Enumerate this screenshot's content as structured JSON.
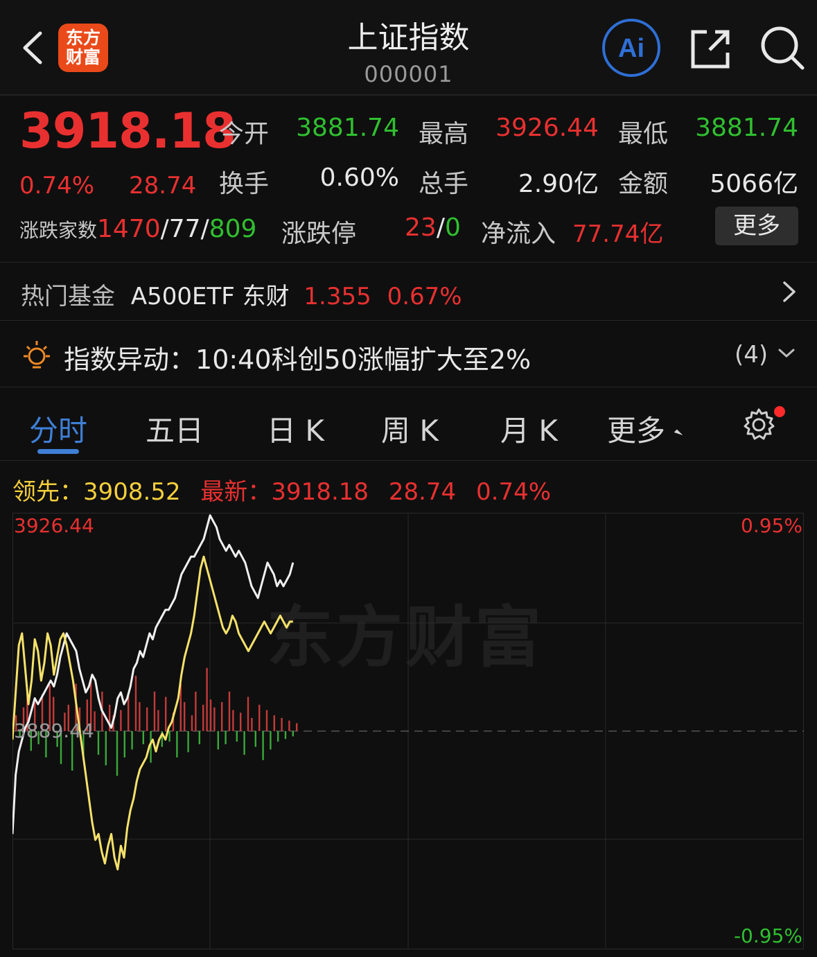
{
  "header": {
    "logo_text_line1": "东方",
    "logo_text_line2": "财富",
    "title": "上证指数",
    "code": "000001",
    "ai_label": "Ai",
    "icons": [
      "back-icon",
      "share-icon",
      "search-icon"
    ]
  },
  "quote": {
    "price": "3918.18",
    "change_pct": "0.74%",
    "change_amt": "28.74",
    "open_label": "今开",
    "open": "3881.74",
    "high_label": "最高",
    "high": "3926.44",
    "low_label": "最低",
    "low": "3881.74",
    "turnover_label": "换手",
    "turnover": "0.60%",
    "volume_label": "总手",
    "volume": "2.90亿",
    "amount_label": "金额",
    "amount": "5066亿",
    "adv_label": "涨跌家数",
    "adv_up": "1470",
    "adv_flat": "77",
    "adv_down": "809",
    "limit_label": "涨跌停",
    "limit_up": "23",
    "limit_down": "0",
    "inflow_label": "净流入",
    "inflow": "77.74亿",
    "more_label": "更多",
    "colors": {
      "up": "#e93030",
      "down": "#2fc02f"
    }
  },
  "hot_fund": {
    "label": "热门基金",
    "name": "A500ETF 东财",
    "price": "1.355",
    "pct": "0.67%"
  },
  "alert": {
    "label": "指数异动：",
    "text": "10:40科创50涨幅扩大至2%",
    "count": "(4)"
  },
  "tabs": [
    {
      "label": "分时"
    },
    {
      "label": "五日"
    },
    {
      "label": "日 K"
    },
    {
      "label": "周 K"
    },
    {
      "label": "月 K"
    },
    {
      "label": "更多"
    }
  ],
  "info_line": {
    "lead_label": "领先：",
    "lead": "3908.52",
    "latest_label": "最新：",
    "latest": "3918.18",
    "latest_chg": "28.74",
    "latest_pct": "0.74%"
  },
  "chart_data": {
    "type": "line",
    "watermark": "东方财富",
    "y_top_label": "3926.44",
    "y_mid_label": "3889.44",
    "pct_top_label": "0.95%",
    "pct_bottom_label": "-0.95%",
    "ylim": [
      3852.44,
      3926.44
    ],
    "prev_close": 3889.44,
    "series": [
      {
        "color": "#f0f0f0",
        "values": [
          3872,
          3882,
          3886,
          3888,
          3890,
          3891,
          3893,
          3895,
          3894,
          3895,
          3896,
          3897,
          3898,
          3897,
          3899,
          3902,
          3904,
          3906,
          3905,
          3904,
          3903,
          3900,
          3898,
          3896,
          3897,
          3899,
          3898,
          3895,
          3893,
          3892,
          3891,
          3890,
          3892,
          3895,
          3896,
          3894,
          3895,
          3897,
          3900,
          3901,
          3903,
          3902,
          3904,
          3906,
          3905,
          3907,
          3908,
          3909,
          3910,
          3910,
          3911,
          3912,
          3914,
          3916,
          3917,
          3918,
          3919,
          3919,
          3920,
          3921,
          3922,
          3924,
          3926,
          3925,
          3924,
          3922,
          3921,
          3920,
          3921,
          3920,
          3919,
          3920,
          3919,
          3918,
          3916,
          3914,
          3913,
          3912,
          3914,
          3916,
          3918,
          3917,
          3916,
          3914,
          3915,
          3914,
          3915,
          3916,
          3918
        ]
      },
      {
        "color": "#f5e26a",
        "values": [
          3888,
          3896,
          3904,
          3906,
          3900,
          3894,
          3898,
          3905,
          3903,
          3898,
          3901,
          3906,
          3904,
          3899,
          3902,
          3905,
          3906,
          3904,
          3901,
          3898,
          3894,
          3890,
          3886,
          3882,
          3878,
          3874,
          3871,
          3872,
          3869,
          3867,
          3870,
          3872,
          3868,
          3866,
          3870,
          3868,
          3873,
          3876,
          3878,
          3881,
          3883,
          3884,
          3885,
          3887,
          3888,
          3886,
          3888,
          3889,
          3888,
          3890,
          3891,
          3893,
          3895,
          3899,
          3902,
          3904,
          3906,
          3909,
          3913,
          3917,
          3919,
          3917,
          3915,
          3913,
          3911,
          3909,
          3907,
          3906,
          3907,
          3909,
          3908,
          3906,
          3905,
          3904,
          3903,
          3904,
          3905,
          3906,
          3907,
          3908,
          3907,
          3906,
          3907,
          3908,
          3909,
          3908,
          3907,
          3908,
          3908
        ]
      }
    ],
    "volume_bars": [
      12,
      -5,
      18,
      30,
      -15,
      22,
      -10,
      28,
      -20,
      35,
      26,
      -12,
      -25,
      14,
      20,
      -30,
      36,
      18,
      -22,
      24,
      40,
      15,
      -18,
      30,
      -26,
      20,
      12,
      -34,
      16,
      -20,
      28,
      -14,
      42,
      22,
      -10,
      18,
      -24,
      30,
      16,
      -12,
      26,
      -8,
      14,
      -20,
      36,
      22,
      -16,
      12,
      30,
      -10,
      20,
      48,
      24,
      18,
      -14,
      22,
      -10,
      30,
      16,
      -8,
      14,
      -18,
      26,
      10,
      -12,
      20,
      -22,
      16,
      -14,
      12,
      -8,
      10,
      -6,
      8,
      -4,
      6
    ]
  }
}
